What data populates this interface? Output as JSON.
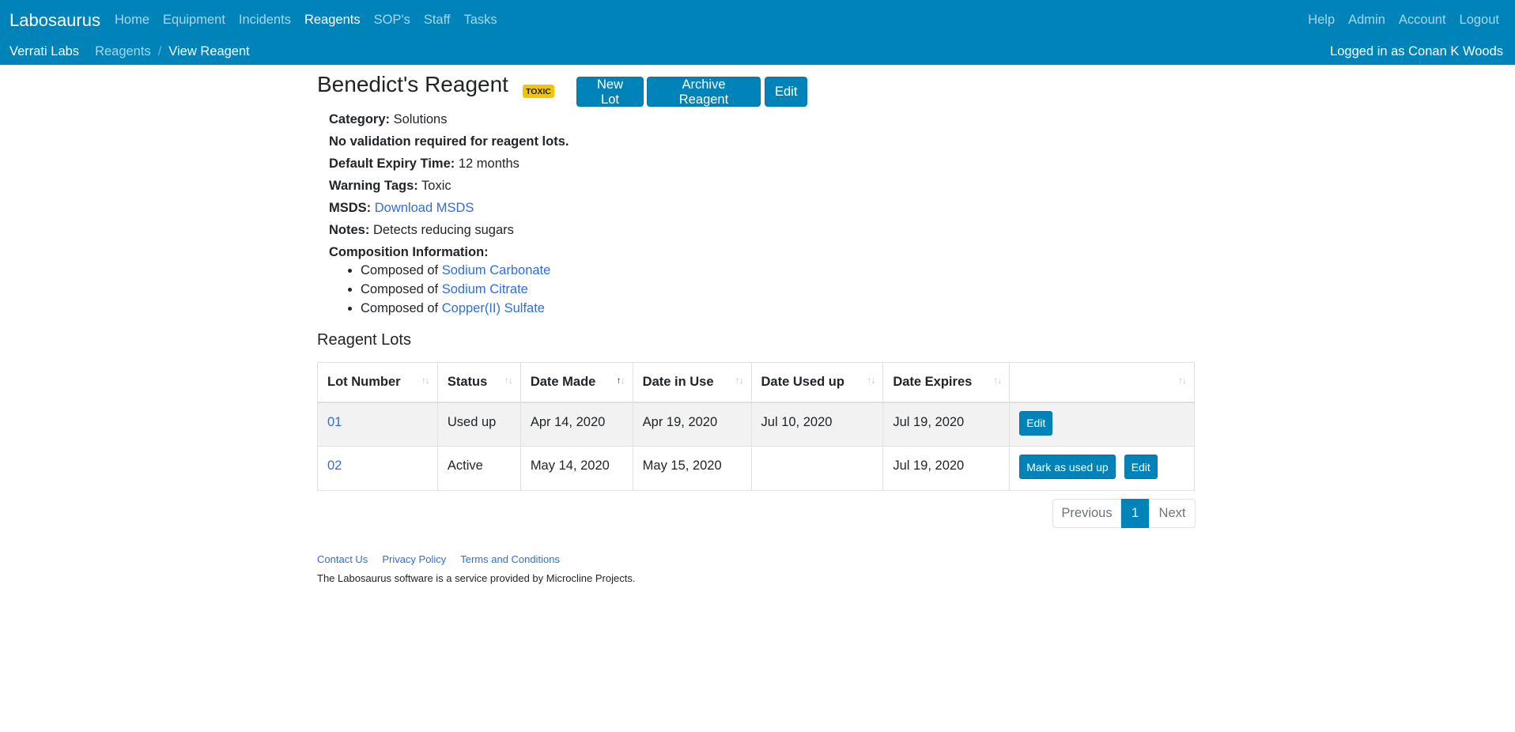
{
  "navbar": {
    "brand": "Labosaurus",
    "items": [
      {
        "label": "Home"
      },
      {
        "label": "Equipment"
      },
      {
        "label": "Incidents"
      },
      {
        "label": "Reagents"
      },
      {
        "label": "SOP's"
      },
      {
        "label": "Staff"
      },
      {
        "label": "Tasks"
      }
    ],
    "active_item": "Reagents",
    "right_items": [
      {
        "label": "Help"
      },
      {
        "label": "Admin"
      },
      {
        "label": "Account"
      },
      {
        "label": "Logout"
      }
    ],
    "breadcrumb": {
      "lab": "Verrati Labs",
      "section": "Reagents",
      "separator": "/",
      "current": "View Reagent"
    },
    "logged_in": "Logged in as Conan K Woods"
  },
  "reagent": {
    "name": "Benedict's Reagent",
    "badge": "TOXIC",
    "actions": {
      "new_lot": "New Lot",
      "archive": "Archive Reagent",
      "edit": "Edit"
    },
    "category_label": "Category:",
    "category": "Solutions",
    "validation_note": "No validation required for reagent lots.",
    "expiry_label": "Default Expiry Time:",
    "expiry": "12 months",
    "warning_label": "Warning Tags:",
    "warning": "Toxic",
    "msds_label": "MSDS:",
    "msds_link": "Download MSDS",
    "notes_label": "Notes:",
    "notes": "Detects reducing sugars",
    "composition_label": "Composition Information:",
    "composition": [
      {
        "prefix": "Composed of",
        "component": "Sodium Carbonate"
      },
      {
        "prefix": "Composed of",
        "component": "Sodium Citrate"
      },
      {
        "prefix": "Composed of",
        "component": "Copper(II) Sulfate"
      }
    ]
  },
  "lots": {
    "heading": "Reagent Lots",
    "columns": [
      "Lot Number",
      "Status",
      "Date Made",
      "Date in Use",
      "Date Used up",
      "Date Expires",
      ""
    ],
    "sorted_column": "Date Made",
    "sort_direction": "ascending",
    "sort_glyph_up": "↑",
    "sort_glyph_down": "↓",
    "rows": [
      {
        "lot": "01",
        "status": "Used up",
        "made": "Apr 14, 2020",
        "in_use": "Apr 19, 2020",
        "used_up": "Jul 10, 2020",
        "expires": "Jul 19, 2020",
        "actions": [
          "Edit"
        ]
      },
      {
        "lot": "02",
        "status": "Active",
        "made": "May 14, 2020",
        "in_use": "May 15, 2020",
        "used_up": "",
        "expires": "Jul 19, 2020",
        "actions": [
          "Mark as used up",
          "Edit"
        ]
      }
    ]
  },
  "pagination": {
    "previous": "Previous",
    "current_page": "1",
    "next": "Next"
  },
  "footer": {
    "links": [
      {
        "label": "Contact Us"
      },
      {
        "label": "Privacy Policy"
      },
      {
        "label": "Terms and Conditions"
      }
    ],
    "text": "The Labosaurus software is a service provided by Microcline Projects."
  },
  "colors": {
    "primary": "#0083b8",
    "badge": "#f5c400",
    "link": "#2f6fd6"
  }
}
